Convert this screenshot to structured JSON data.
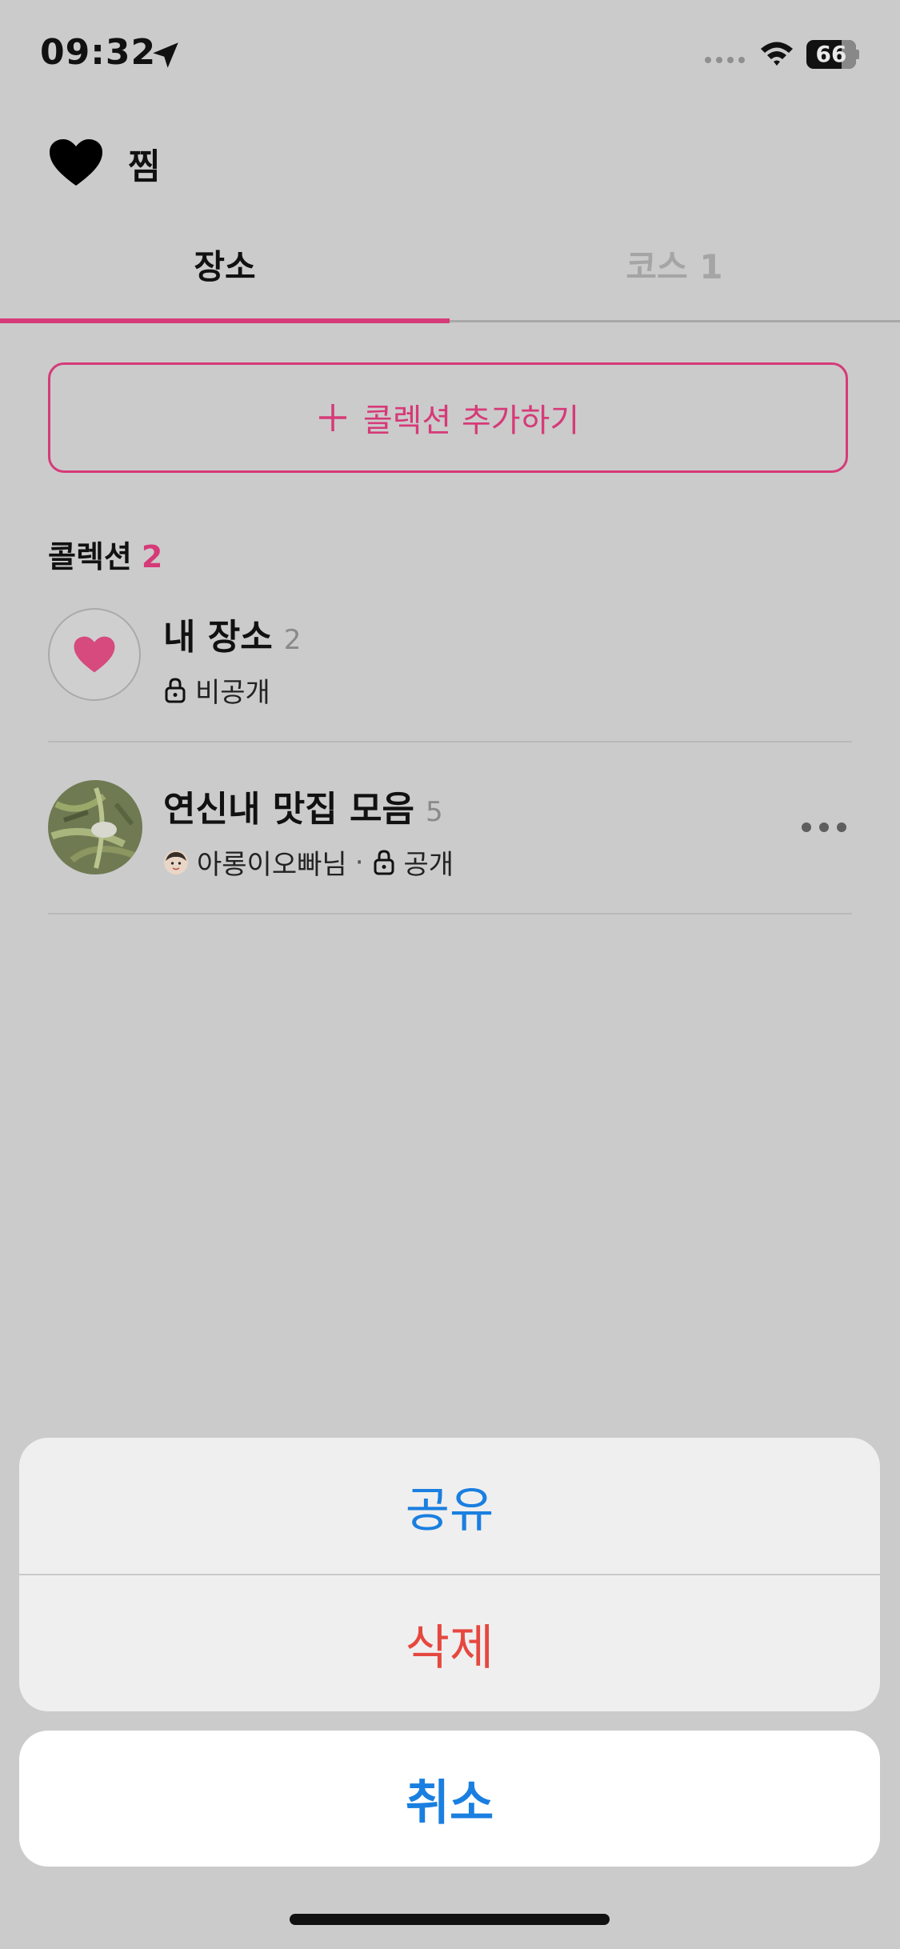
{
  "status_bar": {
    "time": "09:32",
    "battery": "66"
  },
  "header": {
    "title": "찜"
  },
  "tabs": [
    {
      "label": "장소"
    },
    {
      "label": "코스 1"
    }
  ],
  "add_collection": {
    "label": "콜렉션 추가하기"
  },
  "section": {
    "title": "콜렉션",
    "count": "2"
  },
  "collections": [
    {
      "name": "내 장소",
      "count": "2",
      "visibility": "비공개"
    },
    {
      "name": "연신내 맛집 모음",
      "count": "5",
      "owner": "아롱이오빠님",
      "separator": "·",
      "visibility": "공개"
    }
  ],
  "action_sheet": {
    "share": "공유",
    "delete": "삭제",
    "cancel": "취소"
  },
  "colors": {
    "accent": "#d63a78",
    "ios_blue": "#1a7fe0",
    "destructive": "#e5483f"
  }
}
